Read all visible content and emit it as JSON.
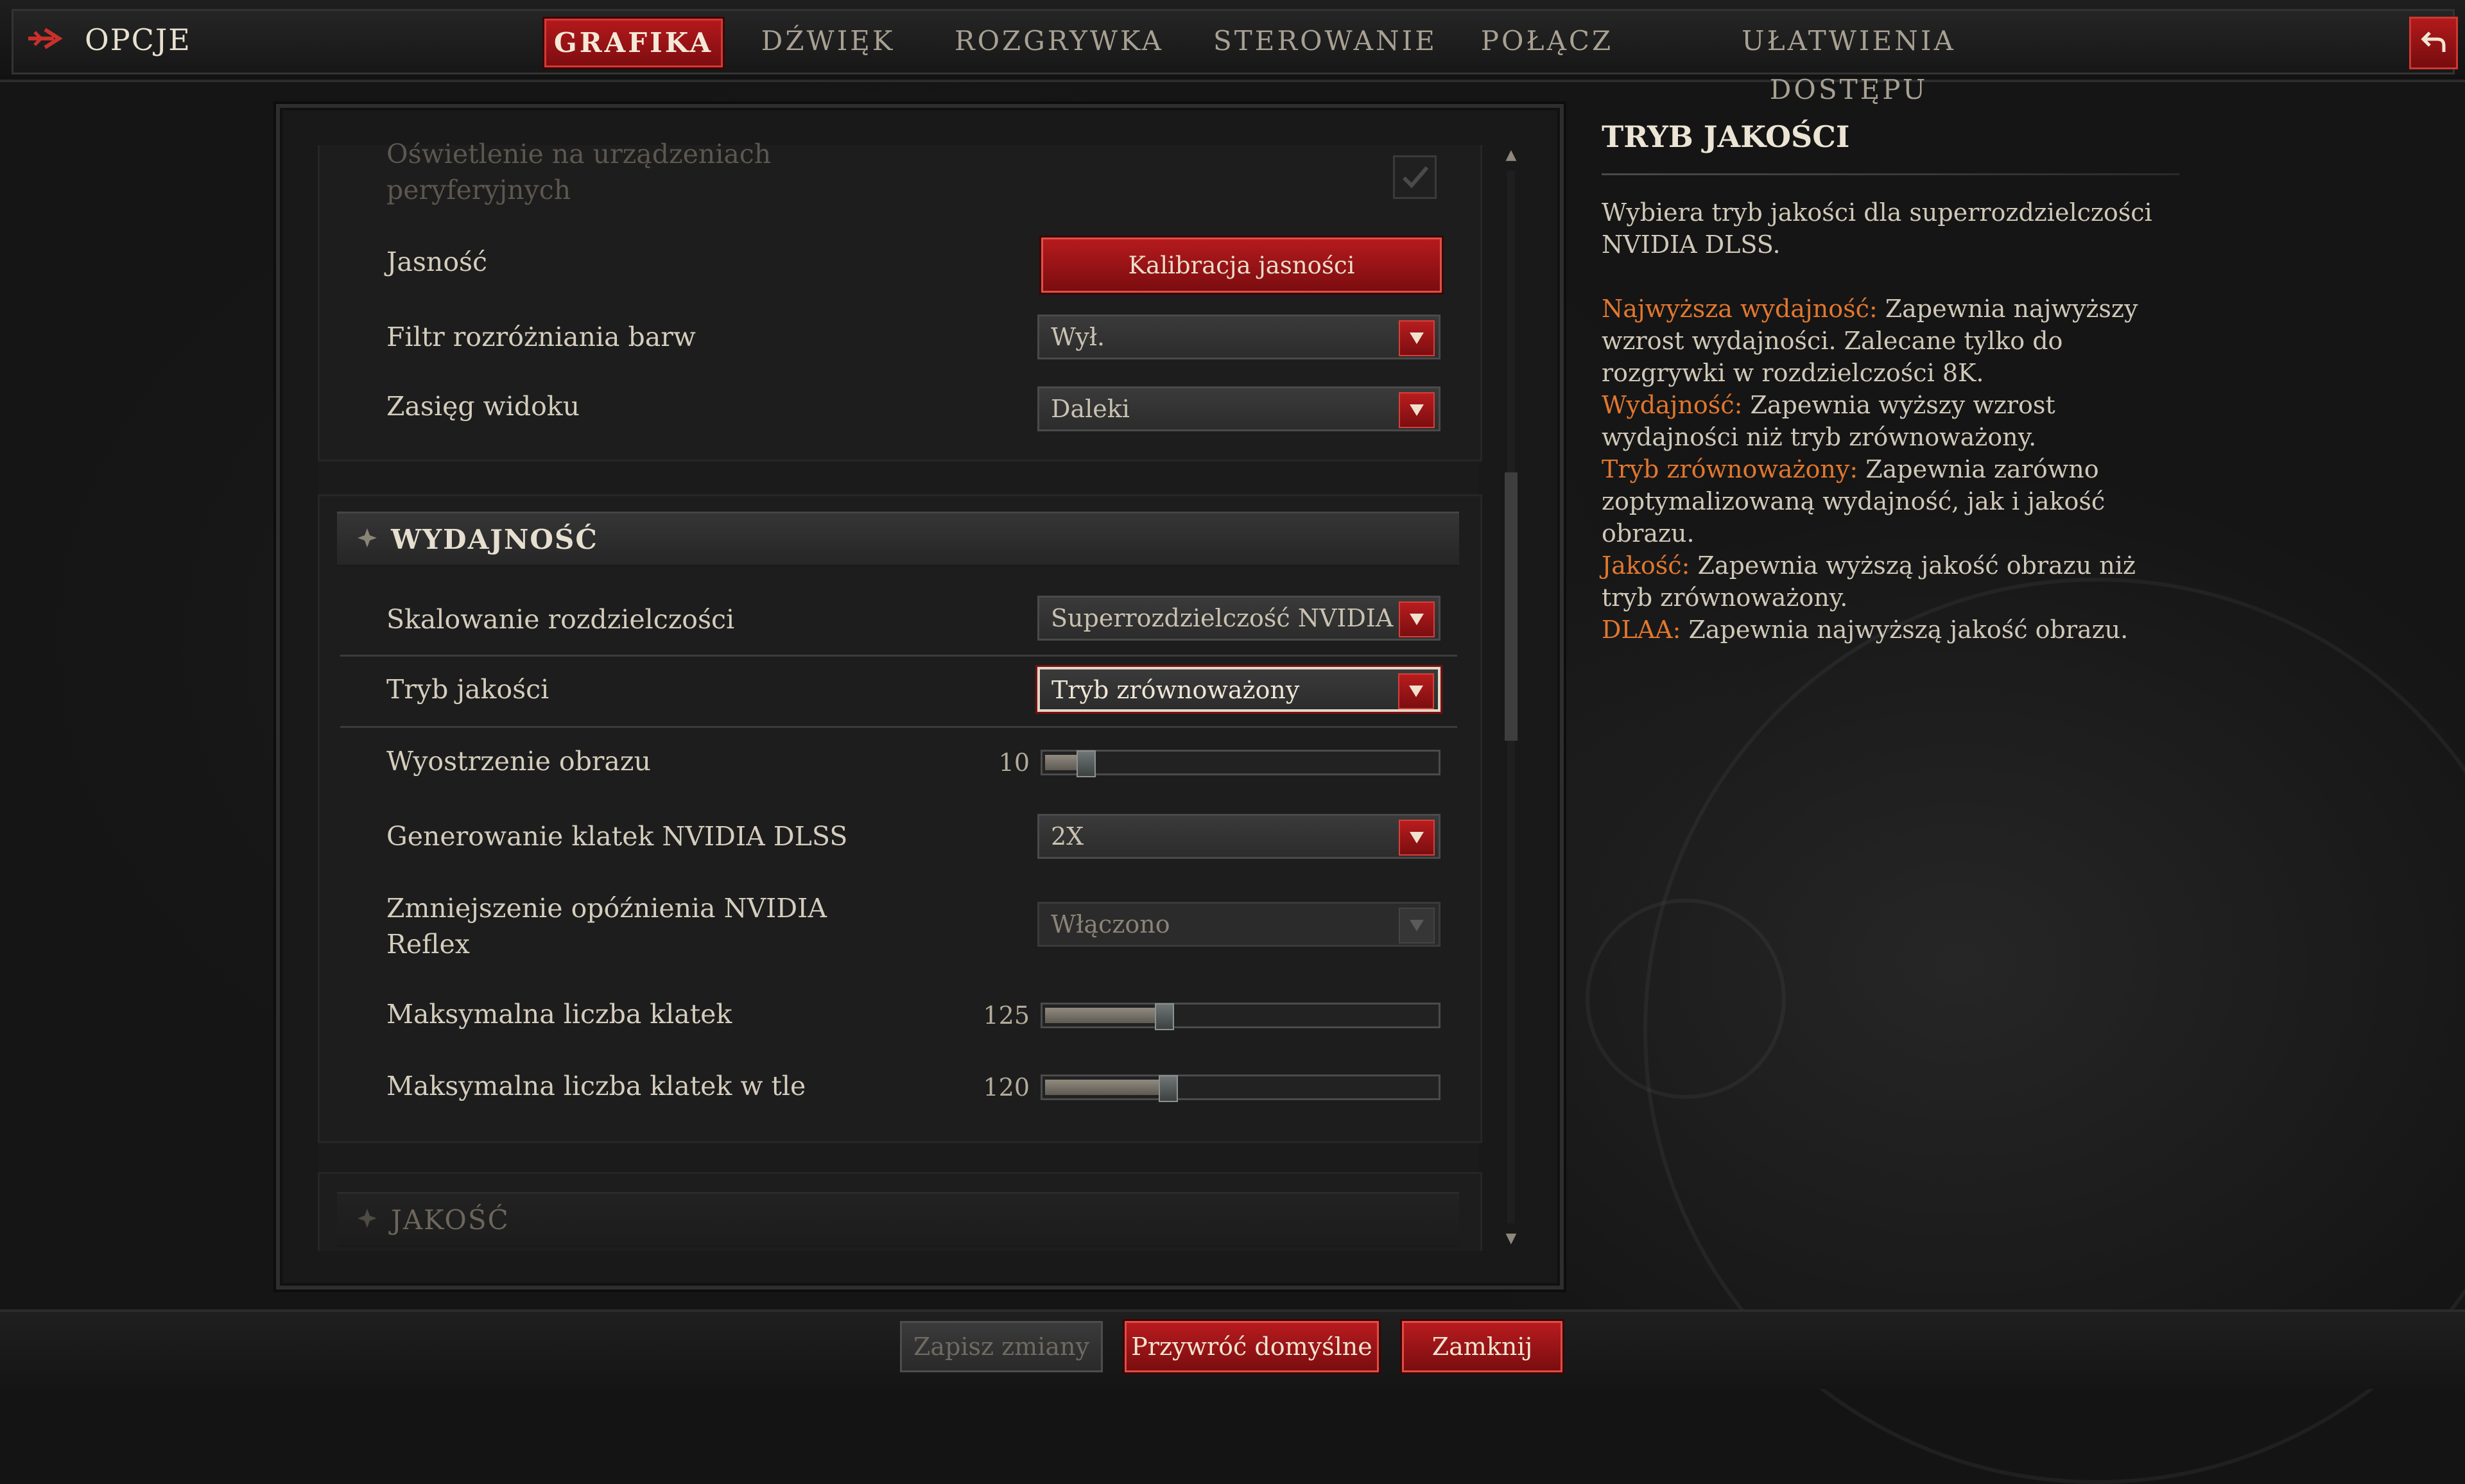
{
  "header": {
    "title": "OPCJE",
    "tabs": [
      {
        "label": "GRAFIKA",
        "active": true
      },
      {
        "label": "DŹWIĘK"
      },
      {
        "label": "ROZGRYWKA"
      },
      {
        "label": "STEROWANIE"
      },
      {
        "label": "POŁĄCZ"
      },
      {
        "label": "UŁATWIENIA DOSTĘPU"
      }
    ]
  },
  "settings": {
    "peripheral_lighting": {
      "label": "Oświetlenie na urządzeniach peryferyjnych",
      "checked": true
    },
    "brightness": {
      "label": "Jasność",
      "button": "Kalibracja jasności"
    },
    "color_filter": {
      "label": "Filtr rozróżniania barw",
      "value": "Wył."
    },
    "view_distance": {
      "label": "Zasięg widoku",
      "value": "Daleki"
    },
    "performance_section": {
      "title": "WYDAJNOŚĆ"
    },
    "resolution_scaling": {
      "label": "Skalowanie rozdzielczości",
      "value": "Superrozdzielczość NVIDIA DLSS"
    },
    "quality_mode": {
      "label": "Tryb jakości",
      "value": "Tryb zrównoważony"
    },
    "sharpening": {
      "label": "Wyostrzenie obrazu",
      "value": "10",
      "fraction": 0.1
    },
    "frame_generation": {
      "label": "Generowanie klatek NVIDIA DLSS",
      "value": "2X"
    },
    "reflex": {
      "label_line1": "Zmniejszenie opóźnienia NVIDIA",
      "label_line2": "Reflex",
      "value": "Włączono"
    },
    "max_fps": {
      "label": "Maksymalna liczba klatek",
      "value": "125",
      "fraction": 0.3
    },
    "max_fps_bg": {
      "label": "Maksymalna liczba klatek w tle",
      "value": "120",
      "fraction": 0.31
    },
    "quality_section": {
      "title": "JAKOŚĆ"
    }
  },
  "info": {
    "title": "TRYB JAKOŚCI",
    "description": "Wybiera tryb jakości dla superrozdzielczości NVIDIA DLSS.",
    "options": [
      {
        "key": "Najwyższa wydajność:",
        "text": " Zapewnia najwyższy wzrost wydajności. Zalecane tylko do rozgrywki w rozdzielczości 8K."
      },
      {
        "key": "Wydajność:",
        "text": " Zapewnia wyższy wzrost wydajności niż tryb zrównoważony."
      },
      {
        "key": "Tryb zrównoważony:",
        "text": " Zapewnia zarówno zoptymalizowaną wydajność, jak i jakość obrazu."
      },
      {
        "key": "Jakość:",
        "text": " Zapewnia wyższą jakość obrazu niż tryb zrównoważony."
      },
      {
        "key": "DLAA:",
        "text": " Zapewnia najwyższą jakość obrazu."
      }
    ],
    "accent_color": "#e2772e"
  },
  "footer": {
    "save": "Zapisz zmiany",
    "defaults": "Przywróć domyślne",
    "close": "Zamknij"
  },
  "colors": {
    "accent_red": "#b51a1d",
    "background": "#151515"
  }
}
